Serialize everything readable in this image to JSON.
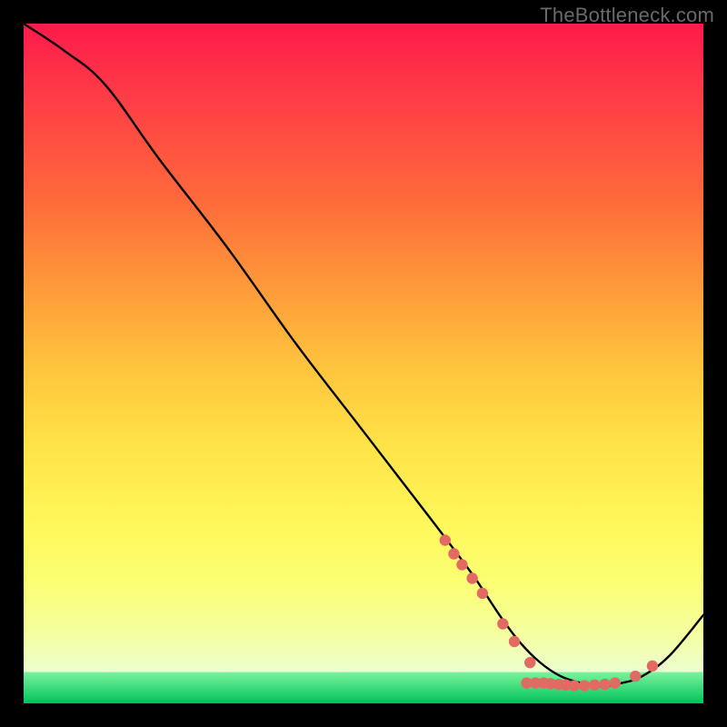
{
  "watermark": "TheBottleneck.com",
  "chart_data": {
    "type": "line",
    "title": "",
    "xlabel": "",
    "ylabel": "",
    "xlim": [
      0,
      100
    ],
    "ylim": [
      0,
      100
    ],
    "series": [
      {
        "name": "curve",
        "x": [
          0,
          6,
          12,
          20,
          30,
          40,
          50,
          60,
          66,
          70,
          73,
          76,
          79,
          82,
          85,
          88,
          91,
          95,
          100
        ],
        "y": [
          100,
          96,
          91,
          80,
          67,
          53,
          40,
          27,
          19,
          13,
          9,
          6,
          4,
          3,
          2.5,
          3,
          4,
          7,
          13
        ]
      }
    ],
    "markers": [
      {
        "x": 62.0,
        "y": 24.0
      },
      {
        "x": 63.3,
        "y": 22.0
      },
      {
        "x": 64.5,
        "y": 20.4
      },
      {
        "x": 66.0,
        "y": 18.4
      },
      {
        "x": 67.5,
        "y": 16.2
      },
      {
        "x": 70.5,
        "y": 11.7
      },
      {
        "x": 72.2,
        "y": 9.1
      },
      {
        "x": 74.5,
        "y": 6.0
      },
      {
        "x": 74.0,
        "y": 3.0
      },
      {
        "x": 75.3,
        "y": 3.0
      },
      {
        "x": 76.5,
        "y": 3.0
      },
      {
        "x": 77.5,
        "y": 2.9
      },
      {
        "x": 78.7,
        "y": 2.8
      },
      {
        "x": 79.8,
        "y": 2.7
      },
      {
        "x": 81.0,
        "y": 2.6
      },
      {
        "x": 82.5,
        "y": 2.6
      },
      {
        "x": 84.0,
        "y": 2.7
      },
      {
        "x": 85.5,
        "y": 2.8
      },
      {
        "x": 87.0,
        "y": 3.0
      },
      {
        "x": 90.0,
        "y": 4.0
      },
      {
        "x": 92.5,
        "y": 5.5
      }
    ],
    "marker_color": "#e26a62",
    "curve_color": "#000000"
  }
}
